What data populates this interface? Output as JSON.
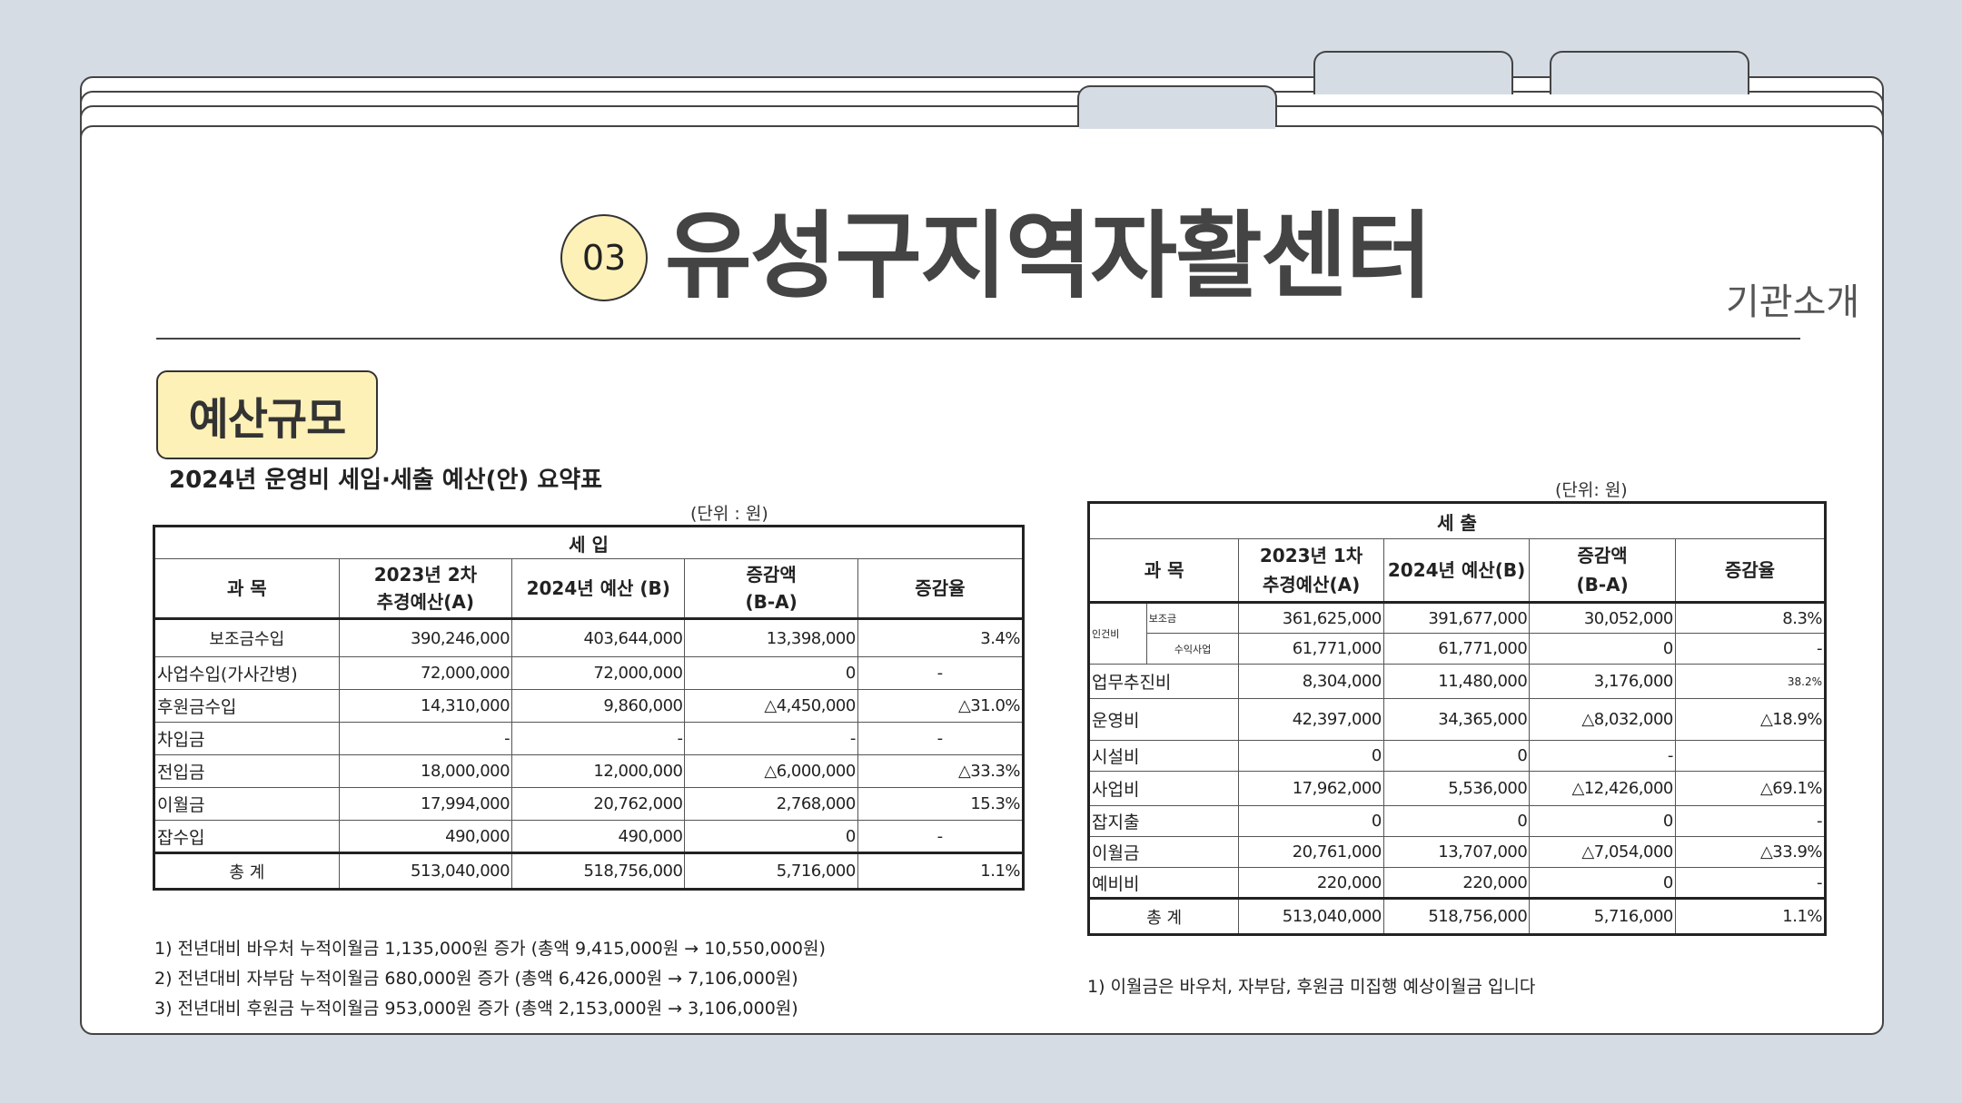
{
  "header": {
    "number": "03",
    "title": "유성구지역자활센터",
    "subtitle": "기관소개"
  },
  "section_label": "예산규모",
  "doc_title": "2024년 운영비 세입·세출 예산(안) 요약표",
  "income": {
    "unit": "(단위 : 원)",
    "group_header": "세 입",
    "headers": [
      "과 목",
      "2023년 2차\n추경예산(A)",
      "2024년 예산 (B)",
      "증감액\n(B-A)",
      "증감율"
    ],
    "rows": [
      [
        "보조금수입",
        "390,246,000",
        "403,644,000",
        "13,398,000",
        "3.4%"
      ],
      [
        "사업수입(가사간병)",
        "72,000,000",
        "72,000,000",
        "0",
        "-"
      ],
      [
        "후원금수입",
        "14,310,000",
        "9,860,000",
        "△4,450,000",
        "△31.0%"
      ],
      [
        "차입금",
        "-",
        "-",
        "-",
        "-"
      ],
      [
        "전입금",
        "18,000,000",
        "12,000,000",
        "△6,000,000",
        "△33.3%"
      ],
      [
        "이월금",
        "17,994,000",
        "20,762,000",
        "2,768,000",
        "15.3%"
      ],
      [
        "잡수입",
        "490,000",
        "490,000",
        "0",
        "-"
      ]
    ],
    "total": [
      "총 계",
      "513,040,000",
      "518,756,000",
      "5,716,000",
      "1.1%"
    ],
    "notes": [
      "1) 전년대비 바우처 누적이월금 1,135,000원 증가 (총액 9,415,000원 → 10,550,000원)",
      "2) 전년대비 자부담 누적이월금 680,000원 증가 (총액 6,426,000원 → 7,106,000원)",
      "3) 전년대비 후원금 누적이월금 953,000원 증가 (총액 2,153,000원 → 3,106,000원)"
    ]
  },
  "expense": {
    "unit": "(단위: 원)",
    "group_header": "세 출",
    "headers": [
      "과 목",
      "2023년 1차\n추경예산(A)",
      "2024년 예산(B)",
      "증감액\n(B-A)",
      "증감율"
    ],
    "personnel_label": "인건비",
    "personnel_rows": [
      [
        "보조금",
        "361,625,000",
        "391,677,000",
        "30,052,000",
        "8.3%"
      ],
      [
        "수익사업",
        "61,771,000",
        "61,771,000",
        "0",
        "-"
      ]
    ],
    "rows": [
      [
        "업무추진비",
        "8,304,000",
        "11,480,000",
        "3,176,000",
        "38.2%"
      ],
      [
        "운영비",
        "42,397,000",
        "34,365,000",
        "△8,032,000",
        "△18.9%"
      ],
      [
        "시설비",
        "0",
        "0",
        "-",
        ""
      ],
      [
        "사업비",
        "17,962,000",
        "5,536,000",
        "△12,426,000",
        "△69.1%"
      ],
      [
        "잡지출",
        "0",
        "0",
        "0",
        "-"
      ],
      [
        "이월금",
        "20,761,000",
        "13,707,000",
        "△7,054,000",
        "△33.9%"
      ],
      [
        "예비비",
        "220,000",
        "220,000",
        "0",
        "-"
      ]
    ],
    "total": [
      "총 계",
      "513,040,000",
      "518,756,000",
      "5,716,000",
      "1.1%"
    ],
    "notes": [
      "1) 이월금은 바우처, 자부담, 후원금 미집행 예상이월금 입니다"
    ]
  }
}
